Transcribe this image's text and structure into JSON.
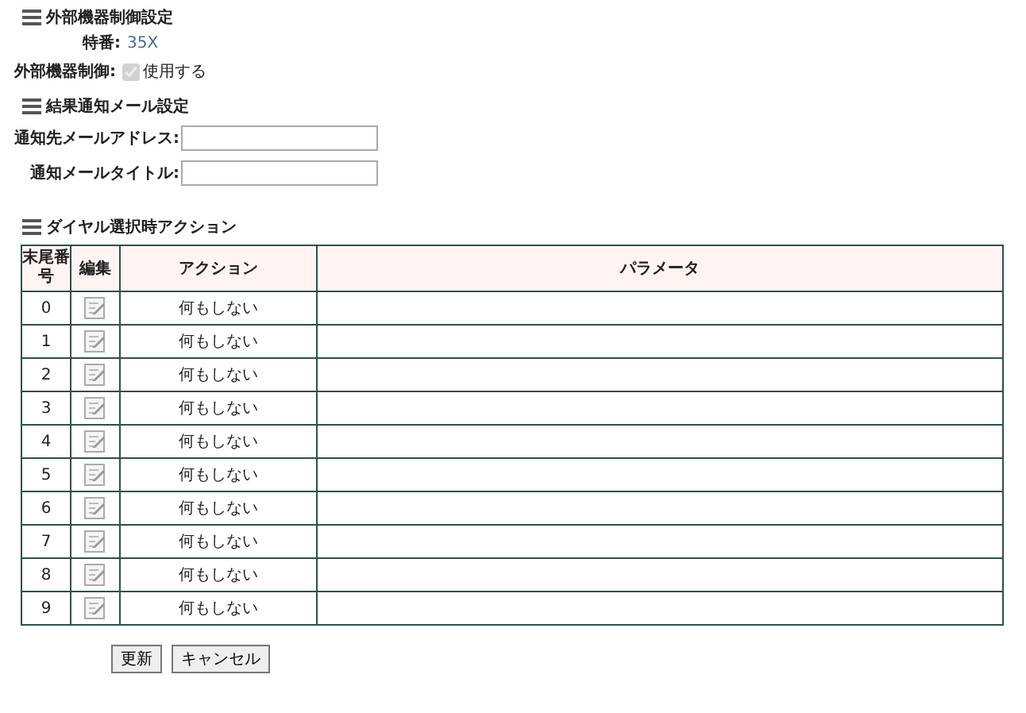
{
  "sections": [
    {
      "title": "外部機器制御設定"
    },
    {
      "title": "結果通知メール設定"
    },
    {
      "title": "ダイヤル選択時アクション"
    }
  ],
  "device": {
    "number_label": "特番:",
    "number_value": "35X",
    "control_label": "外部機器制御:",
    "control_checkbox": {
      "label": "使用する",
      "checked": true,
      "disabled": true
    }
  },
  "mail": {
    "fields": [
      {
        "label": "通知先メールアドレス:"
      },
      {
        "label": "通知メールタイトル:"
      }
    ]
  },
  "table": {
    "columns": [
      "末尾番号",
      "編集",
      "アクション",
      "パラメータ"
    ],
    "rows": [
      {
        "number": "0",
        "action": "何もしない"
      },
      {
        "number": "1",
        "action": "何もしない"
      },
      {
        "number": "2",
        "action": "何もしない"
      },
      {
        "number": "3",
        "action": "何もしない"
      },
      {
        "number": "4",
        "action": "何もしない"
      },
      {
        "number": "5",
        "action": "何もしない"
      },
      {
        "number": "6",
        "action": "何もしない"
      },
      {
        "number": "7",
        "action": "何もしない"
      },
      {
        "number": "8",
        "action": "何もしない"
      },
      {
        "number": "9",
        "action": "何もしない"
      }
    ]
  },
  "buttons": [
    "更新",
    "キャンセル"
  ]
}
